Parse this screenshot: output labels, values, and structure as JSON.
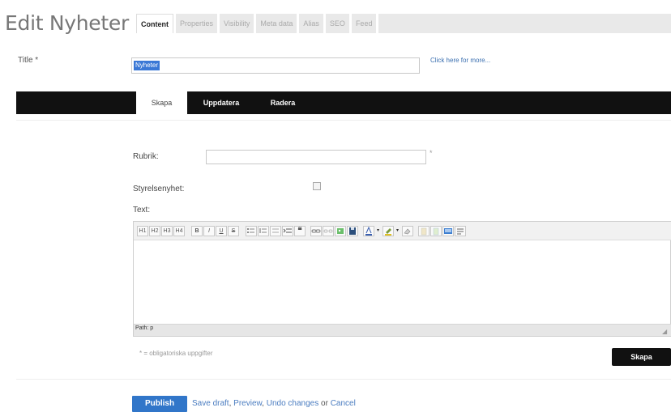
{
  "header": {
    "title": "Edit Nyheter",
    "tabs": [
      "Content",
      "Properties",
      "Visibility",
      "Meta data",
      "Alias",
      "SEO",
      "Feed"
    ],
    "active_tab": "Content"
  },
  "title_field": {
    "label": "Title *",
    "value": "Nyheter",
    "help_link": "Click here for more..."
  },
  "action_bar": {
    "items": [
      "Skapa",
      "Uppdatera",
      "Radera"
    ],
    "active": "Skapa"
  },
  "form": {
    "rubrik_label": "Rubrik:",
    "rubrik_value": "",
    "required_marker": "*",
    "styrelse_label": "Styrelsenyhet:",
    "styrelse_checked": false,
    "text_label": "Text:"
  },
  "editor": {
    "toolbar_icons": [
      "h1-icon",
      "h2-icon",
      "h3-icon",
      "h4-icon",
      "bold-icon",
      "italic-icon",
      "underline-icon",
      "strikethrough-icon",
      "bullet-list-icon",
      "numbered-list-icon",
      "outdent-icon",
      "indent-icon",
      "blockquote-icon",
      "link-icon",
      "unlink-icon",
      "image-icon",
      "save-icon",
      "text-color-icon",
      "highlight-color-icon",
      "cleanup-icon",
      "paste-icon",
      "paste-text-icon",
      "media-icon",
      "template-icon"
    ],
    "toolbar_glyphs": {
      "h1": "H1",
      "h2": "H2",
      "h3": "H3",
      "h4": "H4",
      "bold": "B",
      "italic": "I",
      "underline": "U",
      "strike": "S",
      "quote": "❝",
      "dropdown": "▾"
    },
    "path_label": "Path: p",
    "resize_glyph": "◢"
  },
  "required_note": "* = obligatoriska uppgifter",
  "skapa_button": "Skapa",
  "footer": {
    "publish": "Publish",
    "save_draft": "Save draft",
    "preview": "Preview",
    "undo": "Undo changes",
    "or": "or",
    "cancel": "Cancel"
  },
  "colors": {
    "accent": "#3176c9",
    "bar": "#111111",
    "link": "#4a7cc0"
  }
}
